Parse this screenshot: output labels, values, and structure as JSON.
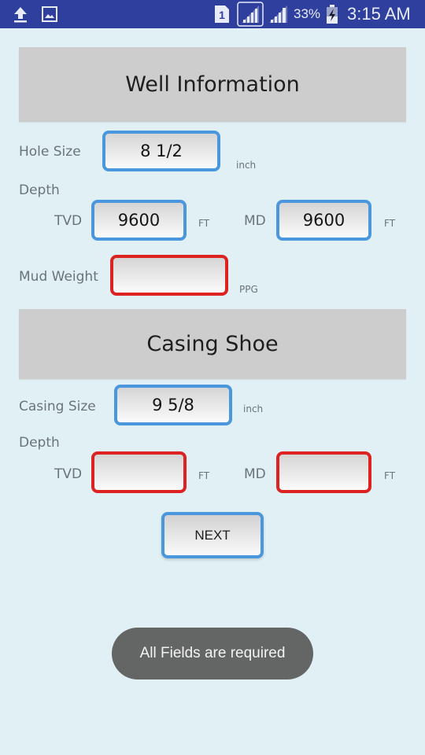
{
  "statusbar": {
    "left_icons": [
      "upload-icon",
      "image-icon"
    ],
    "sim_label": "1",
    "battery_percent": "33%",
    "time": "3:15 AM"
  },
  "well_information": {
    "title": "Well Information",
    "hole_size": {
      "label": "Hole Size",
      "value": "8 1/2",
      "unit": "inch",
      "state": "valid"
    },
    "depth_label": "Depth",
    "tvd": {
      "label": "TVD",
      "value": "9600",
      "unit": "FT",
      "state": "valid"
    },
    "md": {
      "label": "MD",
      "value": "9600",
      "unit": "FT",
      "state": "valid"
    },
    "mud_weight": {
      "label": "Mud Weight",
      "value": "",
      "unit": "PPG",
      "state": "error"
    }
  },
  "casing_shoe": {
    "title": "Casing Shoe",
    "casing_size": {
      "label": "Casing Size",
      "value": "9 5/8",
      "unit": "inch",
      "state": "valid"
    },
    "depth_label": "Depth",
    "tvd": {
      "label": "TVD",
      "value": "",
      "unit": "FT",
      "state": "error"
    },
    "md": {
      "label": "MD",
      "value": "",
      "unit": "FT",
      "state": "error"
    }
  },
  "next_button": {
    "label": "NEXT"
  },
  "toast": {
    "message": "All Fields are required"
  },
  "colors": {
    "statusbar": "#2f3f9e",
    "background": "#e0f0f5",
    "header": "#cdcdcd",
    "valid_border": "#4a97de",
    "error_border": "#dd2222",
    "toast": "#646565"
  }
}
